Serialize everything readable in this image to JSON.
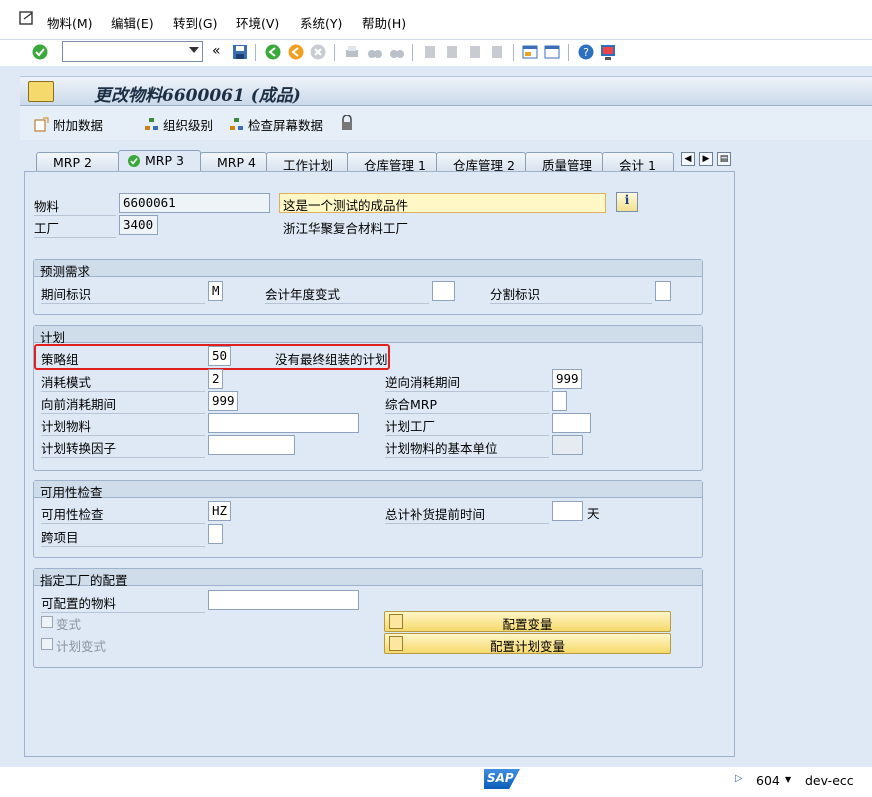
{
  "menu": {
    "items": [
      "物料(M)",
      "编辑(E)",
      "转到(G)",
      "环境(V)",
      "系统(Y)",
      "帮助(H)"
    ]
  },
  "toolbar": {
    "command_value": "",
    "back_symbol": "«"
  },
  "title": "更改物料6600061 (成品)",
  "app_toolbar": {
    "additional_data": "附加数据",
    "org_levels": "组织级别",
    "check_screen": "检查屏幕数据"
  },
  "tabs": [
    "MRP 2",
    "MRP 3",
    "MRP 4",
    "工作计划",
    "仓库管理 1",
    "仓库管理 2",
    "质量管理",
    "会计 1"
  ],
  "header": {
    "material_label": "物料",
    "material_value": "6600061",
    "material_desc": "这是一个测试的成品件",
    "plant_label": "工厂",
    "plant_value": "3400",
    "plant_desc": "浙江华聚复合材料工厂"
  },
  "forecast": {
    "title": "预测需求",
    "period_label": "期间标识",
    "period_value": "M",
    "fiscal_label": "会计年度变式",
    "fiscal_value": "",
    "split_label": "分割标识",
    "split_value": ""
  },
  "planning": {
    "title": "计划",
    "strategy_label": "策略组",
    "strategy_value": "50",
    "strategy_desc": "没有最终组装的计划",
    "consumption_label": "消耗模式",
    "consumption_value": "2",
    "bwd_label": "逆向消耗期间",
    "bwd_value": "999",
    "fwd_label": "向前消耗期间",
    "fwd_value": "999",
    "mixed_label": "综合MRP",
    "mixed_value": "",
    "plan_mat_label": "计划物料",
    "plan_mat_value": "",
    "plan_plant_label": "计划工厂",
    "plan_plant_value": "",
    "conv_label": "计划转换因子",
    "conv_value": "",
    "base_unit_label": "计划物料的基本单位",
    "base_unit_value": ""
  },
  "availability": {
    "title": "可用性检查",
    "check_label": "可用性检查",
    "check_value": "HZ",
    "total_lead_label": "总计补货提前时间",
    "total_lead_value": "",
    "total_lead_unit": "天",
    "cross_label": "跨项目",
    "cross_value": ""
  },
  "config": {
    "title": "指定工厂的配置",
    "configurable_label": "可配置的物料",
    "configurable_value": "",
    "variant_label": "变式",
    "plan_variant_label": "计划变式",
    "config_variant_btn": "配置变量",
    "config_plan_variant_btn": "配置计划变量"
  },
  "status": {
    "client": "604",
    "system": "dev-ecc"
  }
}
